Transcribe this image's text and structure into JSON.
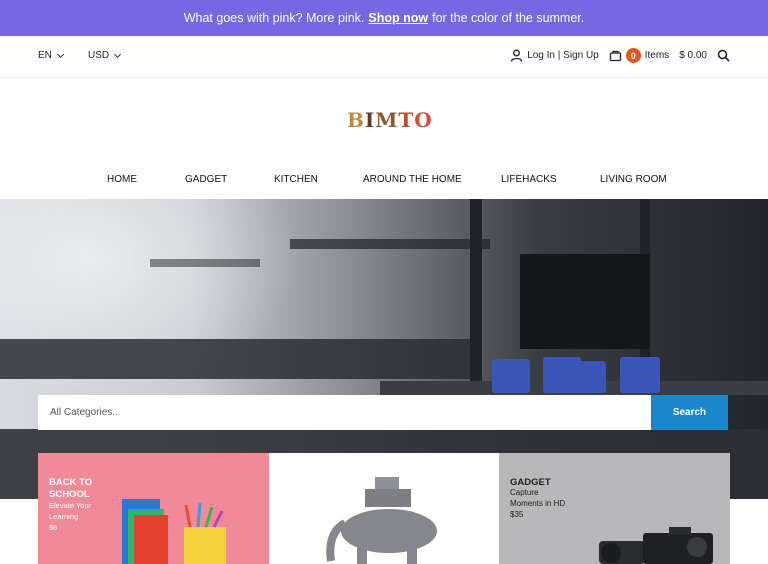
{
  "promo": {
    "text_before": "What goes with pink? More pink.",
    "link": "Shop now",
    "text_after": "for the color of the summer."
  },
  "topbar": {
    "language": "EN",
    "currency": "USD",
    "account_label": "Log In | Sign Up",
    "cart_count": "0",
    "cart_label": "Items",
    "cart_total": "$ 0.00"
  },
  "logo": {
    "letters": [
      "B",
      "I",
      "M",
      "T",
      "O"
    ]
  },
  "nav": {
    "items": [
      "HOME",
      "GADGET",
      "KITCHEN",
      "AROUND THE HOME",
      "LIFEHACKS",
      "LIVING ROOM"
    ]
  },
  "search": {
    "placeholder": "All Categories..",
    "button": "Search"
  },
  "cards": [
    {
      "title": [
        "BACK TO",
        "SCHOOL"
      ],
      "sub": [
        "Elevate Your",
        "Learning",
        "$6"
      ]
    },
    {
      "title": [],
      "sub": []
    },
    {
      "title": [
        "GADGET"
      ],
      "sub": [
        "Capture",
        "Moments in HD",
        "$35"
      ]
    }
  ],
  "colors": {
    "promo_bg": "#7469e2",
    "cart_badge": "#e8541c",
    "search_button": "#1a86cc",
    "card1_bg": "#f08a98",
    "card3_bg": "#b8b8ba"
  },
  "icons": [
    "chevron-down-icon",
    "user-icon",
    "cart-icon",
    "search-icon"
  ]
}
